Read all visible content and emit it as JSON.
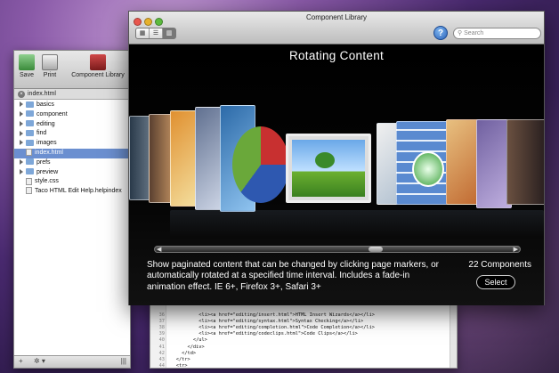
{
  "editor": {
    "toolbar": {
      "save": "Save",
      "print": "Print",
      "component_library": "Component Library"
    },
    "tab": "index.html",
    "files": [
      {
        "label": "basics",
        "type": "folder"
      },
      {
        "label": "component",
        "type": "folder"
      },
      {
        "label": "editing",
        "type": "folder"
      },
      {
        "label": "find",
        "type": "folder"
      },
      {
        "label": "images",
        "type": "folder"
      },
      {
        "label": "index.html",
        "type": "file",
        "selected": true
      },
      {
        "label": "prefs",
        "type": "folder"
      },
      {
        "label": "preview",
        "type": "folder"
      },
      {
        "label": "style.css",
        "type": "file"
      },
      {
        "label": "Taco HTML Edit Help.helpindex",
        "type": "file"
      }
    ],
    "bottom": {
      "add": "+",
      "gear": "✲ ▾",
      "grip": "|||"
    }
  },
  "code": {
    "lines": [
      {
        "n": "36",
        "text": "            <li><a href=\"editing/insert.html\">HTML Insert Wizards</a></li>"
      },
      {
        "n": "37",
        "text": "            <li><a href=\"editing/syntax.html\">Syntax Checking</a></li>"
      },
      {
        "n": "38",
        "text": "            <li><a href=\"editing/completion.html\">Code Completion</a></li>"
      },
      {
        "n": "39",
        "text": "            <li><a href=\"editing/codeclips.html\">Code Clips</a></li>"
      },
      {
        "n": "40",
        "text": "          </ul>"
      },
      {
        "n": "41",
        "text": "        </div>"
      },
      {
        "n": "42",
        "text": "      </td>"
      },
      {
        "n": "43",
        "text": "    </tr>"
      },
      {
        "n": "44",
        "text": "    <tr>"
      }
    ]
  },
  "library": {
    "title": "Component Library",
    "views": [
      "▦",
      "☰",
      "▥"
    ],
    "search_placeholder": "Search",
    "help": "?",
    "heading": "Rotating Content",
    "description": "Show paginated content that can be changed by clicking page markers, or automatically rotated at a specified time interval. Includes a fade-in animation effect. IE 6+, Firefox 3+, Safari 3+",
    "count": "22 Components",
    "select": "Select"
  },
  "colors": {
    "accent": "#6b8fd0",
    "window_bg": "#000000"
  }
}
